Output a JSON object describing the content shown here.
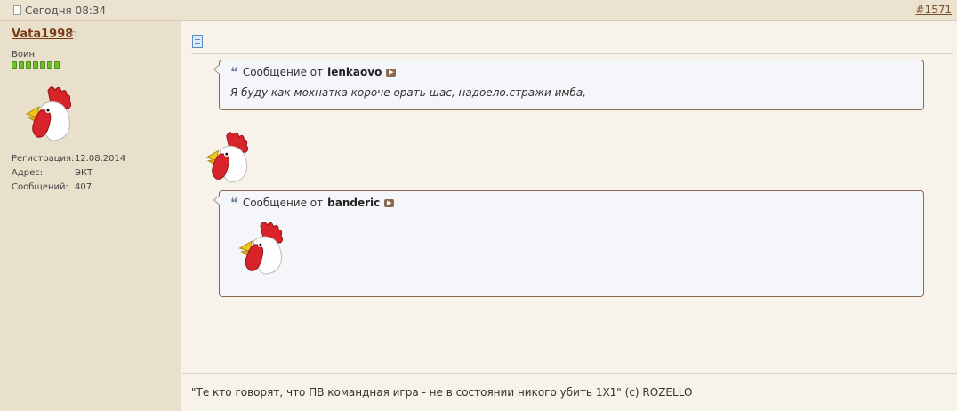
{
  "header": {
    "date": "Сегодня 08:34",
    "post_number": "#1571"
  },
  "user": {
    "name": "Vata1998",
    "rank": "Воин",
    "reputation_pips": 7,
    "info": [
      {
        "label": "Регистрация:",
        "value": "12.08.2014"
      },
      {
        "label": "Адрес:",
        "value": "ЭКТ"
      },
      {
        "label": "Сообщений:",
        "value": "407"
      }
    ]
  },
  "post": {
    "quotes": [
      {
        "prefix": "Сообщение от",
        "author": "lenkaovo",
        "text": "Я буду как мохнатка короче орать щас, надоело.стражи имба,"
      },
      {
        "prefix": "Сообщение от",
        "author": "banderic",
        "text": ""
      }
    ],
    "signature": "\"Те кто говорят, что ПВ командная игра - не в состоянии никого убить 1Х1\" (с) ROZELLO"
  },
  "colors": {
    "accent": "#7a3b16",
    "quote_border": "#8b6a4f",
    "sidebar_bg": "#e9e0cb",
    "post_bg": "#f7f3ea"
  }
}
